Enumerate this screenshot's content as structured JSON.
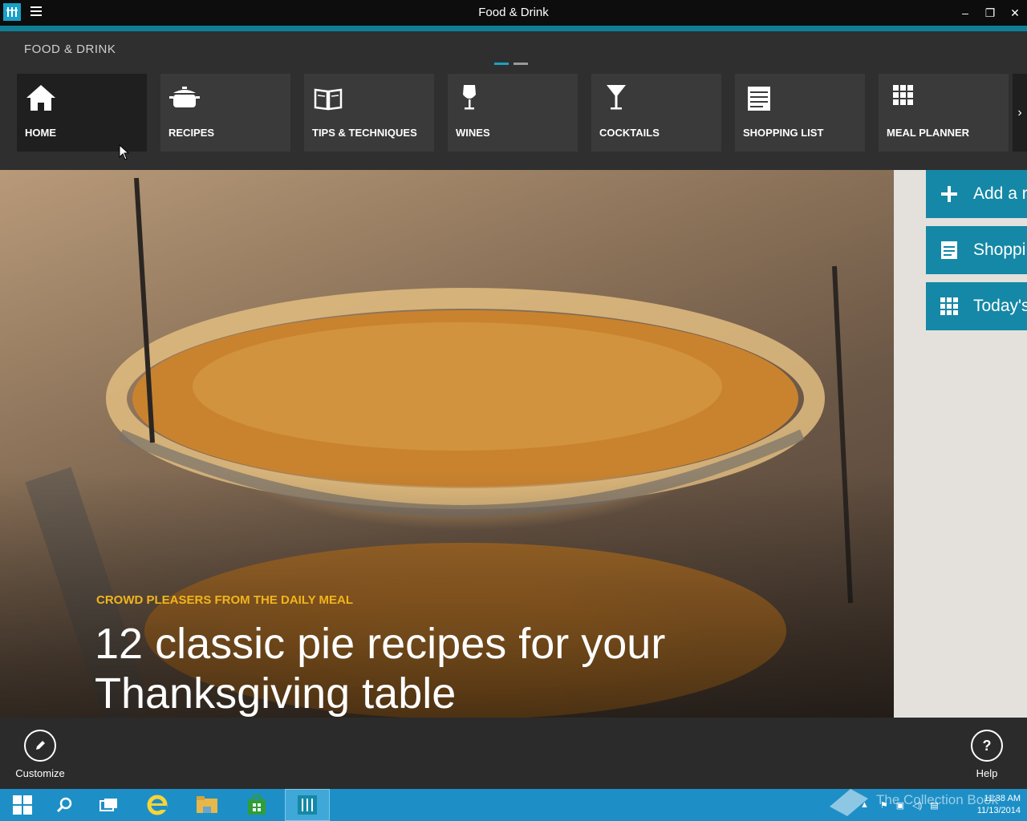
{
  "window": {
    "title": "Food & Drink",
    "minimize_glyph": "–",
    "maximize_glyph": "❐",
    "close_glyph": "✕"
  },
  "nav": {
    "section_title": "FOOD & DRINK",
    "tiles": [
      {
        "label": "HOME",
        "icon": "home-icon"
      },
      {
        "label": "RECIPES",
        "icon": "pot-icon"
      },
      {
        "label": "TIPS & TECHNIQUES",
        "icon": "book-icon"
      },
      {
        "label": "WINES",
        "icon": "wine-glass-icon"
      },
      {
        "label": "COCKTAILS",
        "icon": "cocktail-glass-icon"
      },
      {
        "label": "SHOPPING LIST",
        "icon": "list-icon"
      },
      {
        "label": "MEAL PLANNER",
        "icon": "grid-icon"
      }
    ],
    "next_glyph": "›",
    "pages": 2,
    "current_page": 1
  },
  "hero": {
    "kicker": "CROWD PLEASERS FROM THE DAILY MEAL",
    "headline": "12 classic pie recipes for your Thanksgiving table"
  },
  "quick_actions": [
    {
      "label": "Add a r",
      "icon": "plus-icon"
    },
    {
      "label": "Shoppi",
      "icon": "list-icon"
    },
    {
      "label": "Today's",
      "icon": "grid-icon"
    }
  ],
  "appbar": {
    "customize_label": "Customize",
    "help_label": "Help",
    "help_glyph": "?"
  },
  "taskbar": {
    "watermark": "The Collection Book",
    "time": "11:38 AM",
    "date": "11/13/2014"
  },
  "colors": {
    "accent": "#0e7f95",
    "quick_action": "#1488a6",
    "kicker": "#f2b51c",
    "taskbar": "#1d8fc6"
  }
}
